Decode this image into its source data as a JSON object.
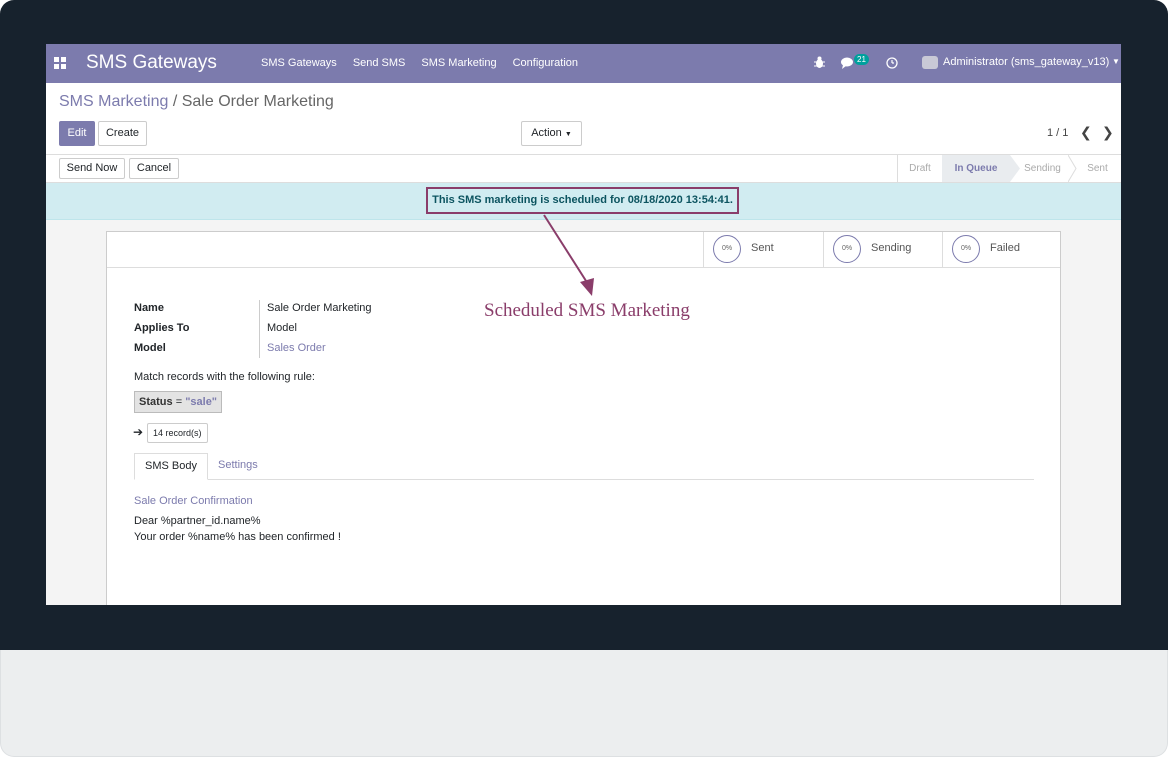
{
  "navbar": {
    "brand": "SMS Gateways",
    "menu": [
      "SMS Gateways",
      "Send SMS",
      "SMS Marketing",
      "Configuration"
    ],
    "messages_count": "21",
    "user": "Administrator (sms_gateway_v13)"
  },
  "breadcrumb": {
    "parent": "SMS Marketing",
    "separator": "/",
    "current": "Sale Order Marketing"
  },
  "toolbar": {
    "edit_label": "Edit",
    "create_label": "Create",
    "action_label": "Action",
    "pager": "1 / 1"
  },
  "statusbar": {
    "send_now_label": "Send Now",
    "cancel_label": "Cancel",
    "stages": [
      "Draft",
      "In Queue",
      "Sending",
      "Sent"
    ],
    "active_stage": "In Queue"
  },
  "alert": {
    "text": "This SMS marketing is scheduled for 08/18/2020 13:54:41."
  },
  "stats": [
    {
      "percent": "0%",
      "label": "Sent"
    },
    {
      "percent": "0%",
      "label": "Sending"
    },
    {
      "percent": "0%",
      "label": "Failed"
    }
  ],
  "fields": {
    "name_label": "Name",
    "name_value": "Sale Order Marketing",
    "applies_label": "Applies To",
    "applies_value": "Model",
    "model_label": "Model",
    "model_value": "Sales Order"
  },
  "annotation": "Scheduled SMS Marketing",
  "rule": {
    "intro": "Match records with the following rule:",
    "field": "Status",
    "operator": "=",
    "value": "\"sale\"",
    "records": "14 record(s)"
  },
  "tabs": [
    "SMS Body",
    "Settings"
  ],
  "sms": {
    "title": "Sale Order Confirmation",
    "line1": "Dear %partner_id.name%",
    "line2": "Your order %name% has been confirmed !"
  },
  "colors": {
    "brand": "#7c7bad",
    "annotation": "#8a3d6a",
    "alert_bg": "#d1ecf1"
  }
}
